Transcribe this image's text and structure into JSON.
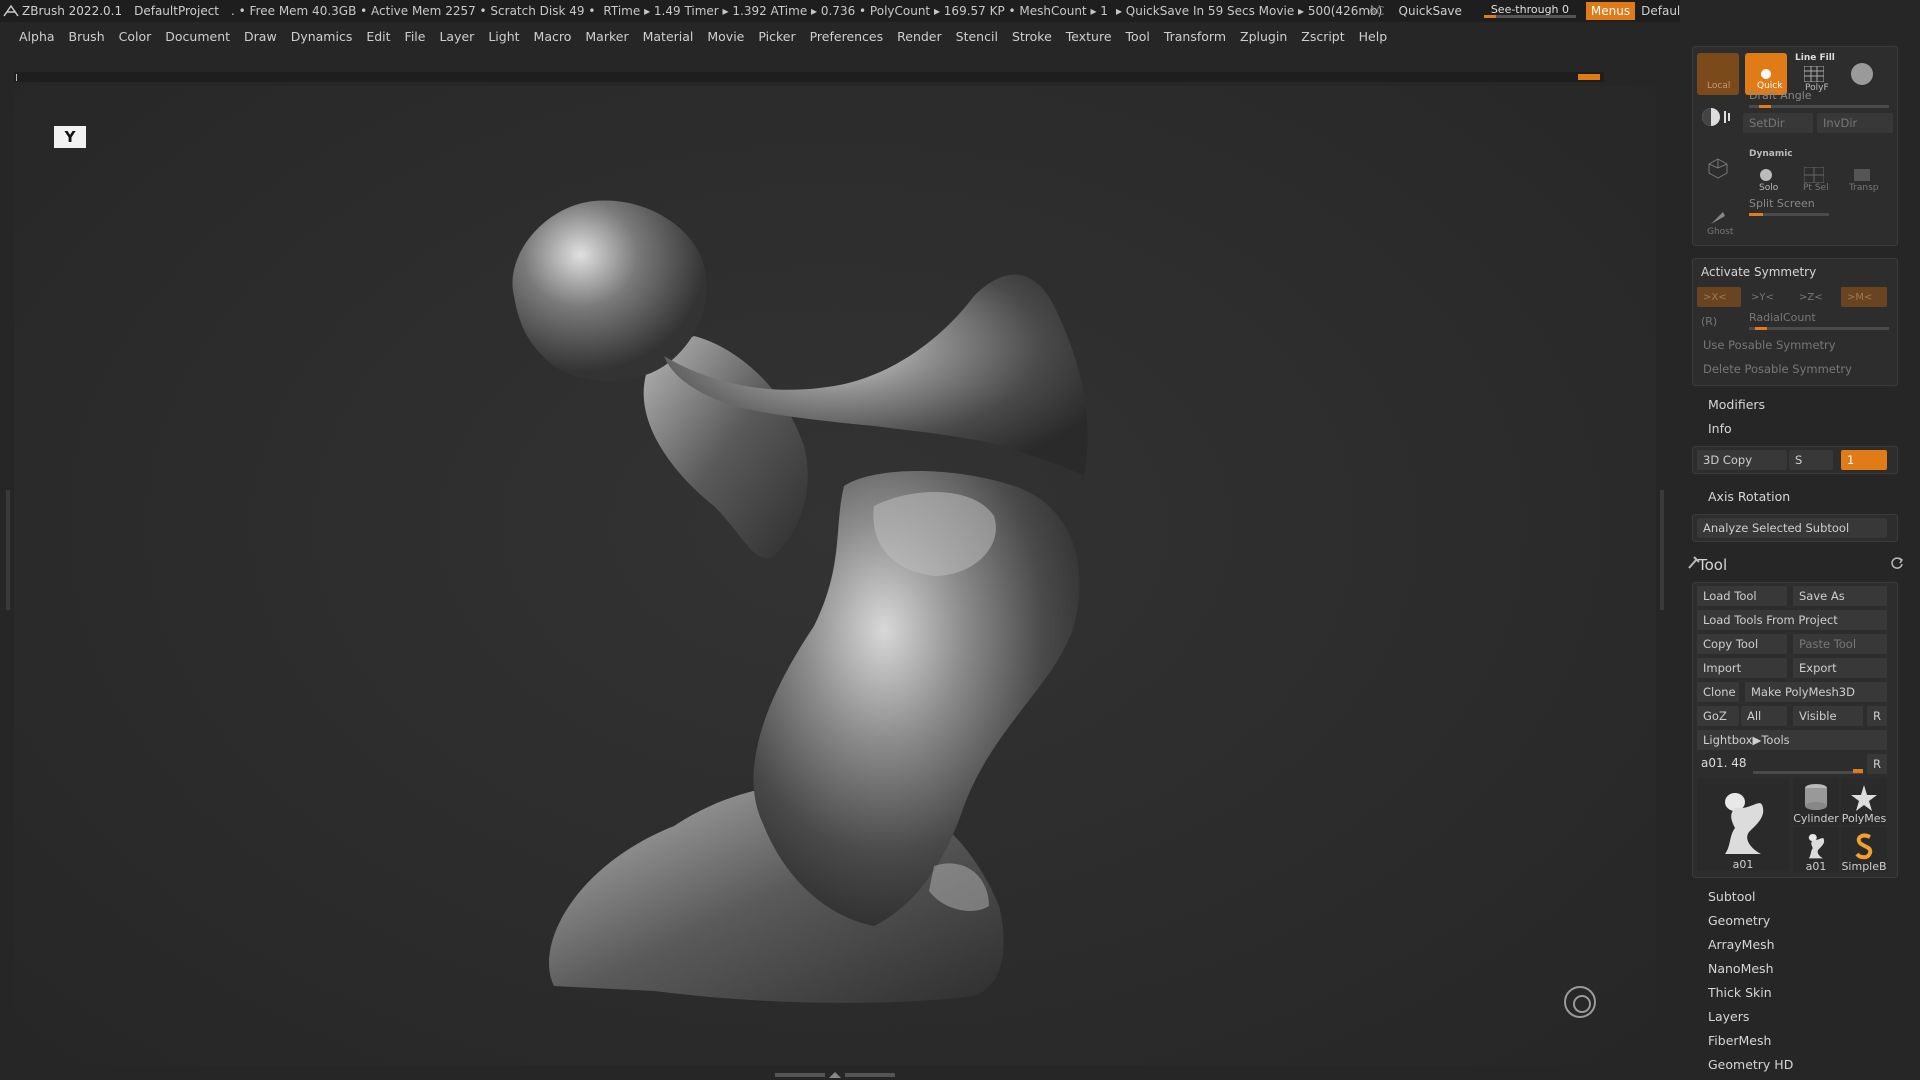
{
  "titlebar": {
    "app": "ZBrush 2022.0.1",
    "project": "DefaultProject",
    "stats": [
      ". • Free Mem 40.3GB • Active Mem 2257 • Scratch Disk 49 •",
      "RTime ▸ 1.49 Timer ▸ 1.392 ATime ▸ 0.736 • PolyCount ▸ 169.57 KP  • MeshCount ▸ 1",
      "▸ QuickSave In 59 Secs Movie ▸ 500(426mb)"
    ],
    "ac": "AC",
    "quicksave": "QuickSave",
    "see_through": "See-through  0",
    "menus": "Menus",
    "zscript": "DefaultZScript"
  },
  "menubar": [
    "Alpha",
    "Brush",
    "Color",
    "Document",
    "Draw",
    "Dynamics",
    "Edit",
    "File",
    "Layer",
    "Light",
    "Macro",
    "Marker",
    "Material",
    "Movie",
    "Picker",
    "Preferences",
    "Render",
    "Stencil",
    "Stroke",
    "Texture",
    "Tool",
    "Transform",
    "Zplugin",
    "Zscript",
    "Help"
  ],
  "canvas": {
    "persp_glyph": "Y"
  },
  "tray": {
    "top_icons": {
      "local": "Local",
      "quick": "Quick",
      "line_fill": "Line Fill",
      "polyf": "PolyF",
      "draft_angle": "Draft Angle",
      "setdir": "SetDir",
      "invdir": "InvDir",
      "dynamic": "Dynamic",
      "solo": "Solo",
      "ptsel": "Pt Sel",
      "transp": "Transp",
      "ghost": "Ghost",
      "split_screen": "Split Screen"
    },
    "symmetry": {
      "title": "Activate Symmetry",
      "x": ">X<",
      "y": ">Y<",
      "z": ">Z<",
      "m": ">M<",
      "r": "(R)",
      "radial": "RadialCount",
      "posable": "Use Posable Symmetry",
      "delete_posable": "Delete Posable Symmetry"
    },
    "modifiers": "Modifiers",
    "info": "Info",
    "copy3d": {
      "label": "3D Copy",
      "s": "S",
      "value": "1"
    },
    "axis_rotation": "Axis Rotation",
    "analyze": "Analyze Selected Subtool",
    "tool": {
      "title": "Tool",
      "load": "Load Tool",
      "save_as": "Save As",
      "load_project": "Load Tools From Project",
      "copy": "Copy Tool",
      "paste": "Paste Tool",
      "import": "Import",
      "export": "Export",
      "clone": "Clone",
      "make_polymesh": "Make PolyMesh3D",
      "goz": "GoZ",
      "all": "All",
      "visible": "Visible",
      "r": "R",
      "lightbox": "Lightbox▶Tools",
      "current": "a01. 48",
      "current_r": "R",
      "thumbs": [
        "a01",
        "Cylinder",
        "PolyMes",
        "a01",
        "SimpleB"
      ]
    },
    "subpalettes": [
      "Subtool",
      "Geometry",
      "ArrayMesh",
      "NanoMesh",
      "Thick Skin",
      "Layers",
      "FiberMesh",
      "Geometry HD"
    ]
  }
}
